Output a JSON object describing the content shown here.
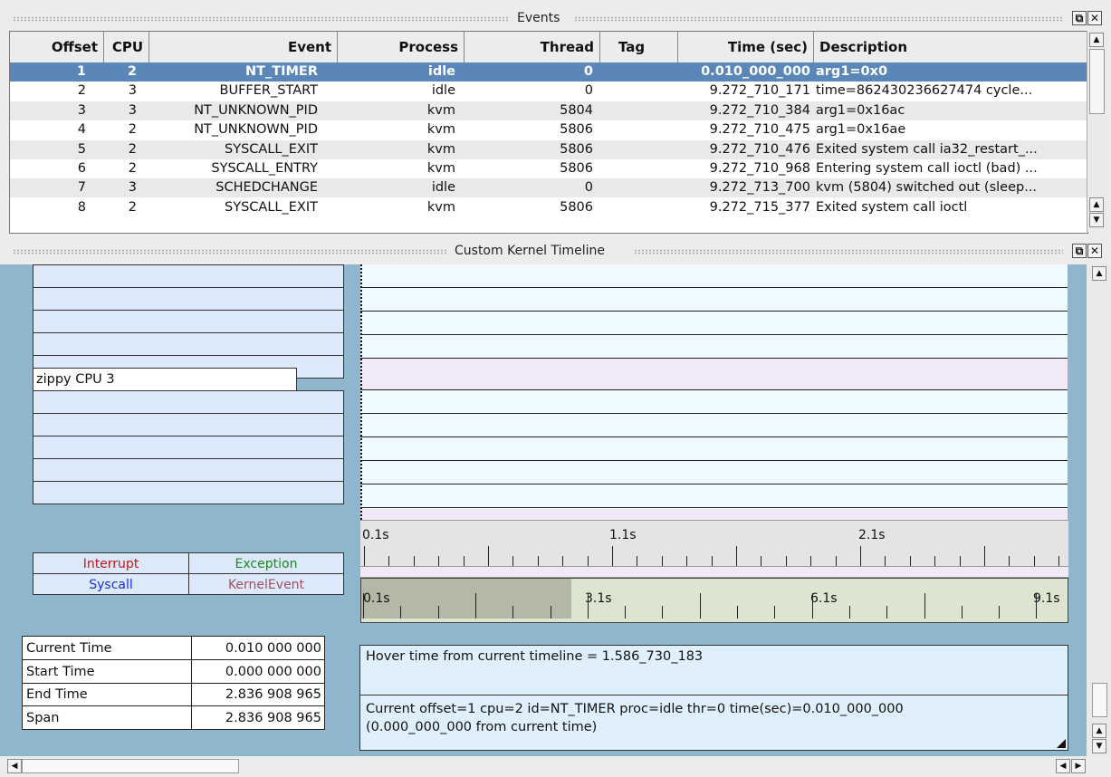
{
  "events_dock": {
    "title": "Events",
    "float_icon": "float-icon",
    "close_icon": "close-icon"
  },
  "table": {
    "columns": [
      "Offset",
      "CPU",
      "Event",
      "Process",
      "Thread",
      "Tag",
      "Time (sec)",
      "Description"
    ],
    "rows": [
      {
        "offset": "1",
        "cpu": "2",
        "event": "NT_TIMER",
        "process": "idle",
        "thread": "0",
        "tag": "",
        "time": "0.010_000_000",
        "desc": "arg1=0x0"
      },
      {
        "offset": "2",
        "cpu": "3",
        "event": "BUFFER_START",
        "process": "idle",
        "thread": "0",
        "tag": "",
        "time": "9.272_710_171",
        "desc": "time=862430236627474 cycle..."
      },
      {
        "offset": "3",
        "cpu": "3",
        "event": "NT_UNKNOWN_PID",
        "process": "kvm",
        "thread": "5804",
        "tag": "",
        "time": "9.272_710_384",
        "desc": "arg1=0x16ac"
      },
      {
        "offset": "4",
        "cpu": "2",
        "event": "NT_UNKNOWN_PID",
        "process": "kvm",
        "thread": "5806",
        "tag": "",
        "time": "9.272_710_475",
        "desc": "arg1=0x16ae"
      },
      {
        "offset": "5",
        "cpu": "2",
        "event": "SYSCALL_EXIT",
        "process": "kvm",
        "thread": "5806",
        "tag": "",
        "time": "9.272_710_476",
        "desc": "Exited system call ia32_restart_..."
      },
      {
        "offset": "6",
        "cpu": "2",
        "event": "SYSCALL_ENTRY",
        "process": "kvm",
        "thread": "5806",
        "tag": "",
        "time": "9.272_710_968",
        "desc": "Entering system call ioctl (bad) ..."
      },
      {
        "offset": "7",
        "cpu": "3",
        "event": "SCHEDCHANGE",
        "process": "idle",
        "thread": "0",
        "tag": "",
        "time": "9.272_713_700",
        "desc": "kvm (5804) switched out (sleep..."
      },
      {
        "offset": "8",
        "cpu": "2",
        "event": "SYSCALL_EXIT",
        "process": "kvm",
        "thread": "5806",
        "tag": "",
        "time": "9.272_715_377",
        "desc": "Exited system call ioctl"
      }
    ]
  },
  "timeline_dock": {
    "title": "Custom Kernel Timeline"
  },
  "timeline": {
    "cpu_label": "zippy CPU 3",
    "ruler_top": [
      "0.1s",
      "1.1s",
      "2.1s"
    ],
    "ruler_bottom": [
      "0.1s",
      "3.1s",
      "6.1s",
      "9.1s"
    ]
  },
  "legend": {
    "interrupt": "Interrupt",
    "exception": "Exception",
    "syscall": "Syscall",
    "kernelevent": "KernelEvent",
    "colors": {
      "interrupt": "#c01818",
      "exception": "#1a8a1a",
      "syscall": "#1a2fd0",
      "kernelevent": "#a05060"
    }
  },
  "times": [
    {
      "label": "Current Time",
      "value": "0.010 000 000"
    },
    {
      "label": "Start Time",
      "value": "0.000 000 000"
    },
    {
      "label": "End Time",
      "value": "2.836 908 965"
    },
    {
      "label": "Span",
      "value": "2.836 908 965"
    }
  ],
  "hover_text": "Hover time from current timeline = 1.586_730_183",
  "current_text_1": "Current offset=1  cpu=2  id=NT_TIMER  proc=idle  thr=0  time(sec)=0.010_000_000",
  "current_text_2": "(0.000_000_000 from current time)"
}
